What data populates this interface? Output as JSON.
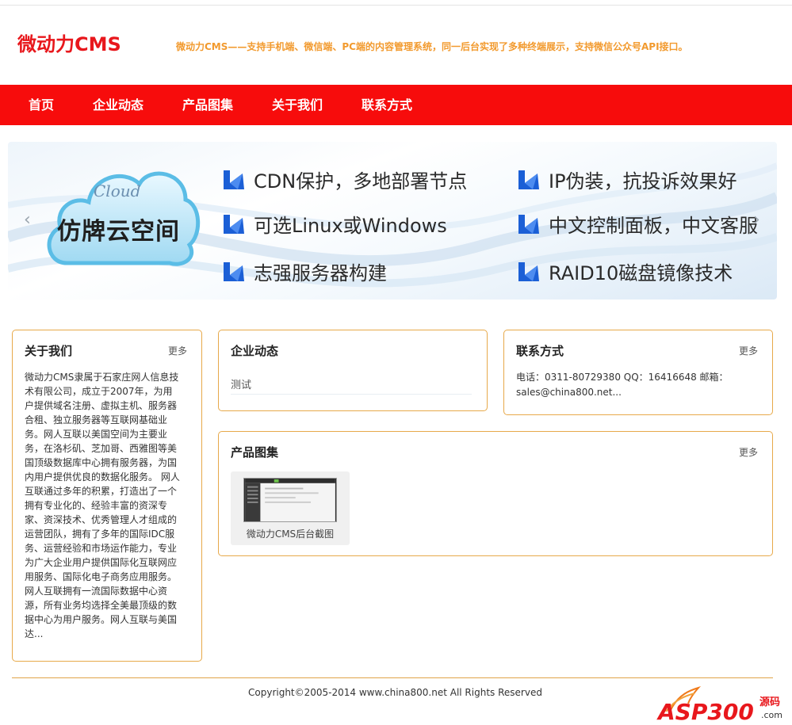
{
  "header": {
    "logo": "微动力CMS",
    "slogan": "微动力CMS——支持手机端、微信端、PC端的内容管理系统，同一后台实现了多种终端展示，支持微信公众号API接口。"
  },
  "nav": {
    "items": [
      {
        "label": "首页"
      },
      {
        "label": "企业动态"
      },
      {
        "label": "产品图集"
      },
      {
        "label": "关于我们"
      },
      {
        "label": "联系方式"
      }
    ]
  },
  "banner": {
    "cloud_word": "Cloud",
    "cloud_title": "仿牌云空间",
    "features_left": [
      "CDN保护，多地部署节点",
      "可选Linux或Windows",
      "志强服务器构建"
    ],
    "features_right": [
      "IP伪装，抗投诉效果好",
      "中文控制面板，中文客服",
      "RAID10磁盘镜像技术"
    ],
    "prev": "‹",
    "next": "›"
  },
  "about": {
    "title": "关于我们",
    "more": "更多",
    "text": "微动力CMS隶属于石家庄网人信息技术有限公司，成立于2007年，为用户提供域名注册、虚拟主机、服务器合租、独立服务器等互联网基础业务。网人互联以美国空间为主要业务，在洛杉矶、芝加哥、西雅图等美国顶级数据库中心拥有服务器，为国内用户提供优良的数据化服务。      网人互联通过多年的积累，打造出了一个拥有专业化的、经验丰富的资深专家、资深技术、优秀管理人才组成的运营团队，拥有了多年的国际IDC服务、运营经验和市场运作能力，专业为广大企业用户提供国际化互联网应用服务、国际化电子商务应用服务。网人互联拥有一流国际数据中心资源，所有业务均选择全美最顶级的数据中心为用户服务。网人互联与美国达..."
  },
  "news": {
    "title": "企业动态",
    "items": [
      "测试"
    ]
  },
  "contact": {
    "title": "联系方式",
    "more": "更多",
    "text": "电话：0311-80729380 QQ：16416648 邮箱：sales@china800.net..."
  },
  "products": {
    "title": "产品图集",
    "more": "更多",
    "items": [
      {
        "caption": "微动力CMS后台截图"
      }
    ]
  },
  "footer": {
    "copyright": "Copyright©2005-2014 www.china800.net All Rights Reserved",
    "watermark": "ASP300",
    "watermark_cn": "源码",
    "watermark_dom": ".com"
  },
  "colors": {
    "nav_bg": "#f70c0c",
    "logo": "#e8171c",
    "slogan": "#f29a2e",
    "box_border": "#e7a94a",
    "feature_icon": "#1b5fd6"
  }
}
